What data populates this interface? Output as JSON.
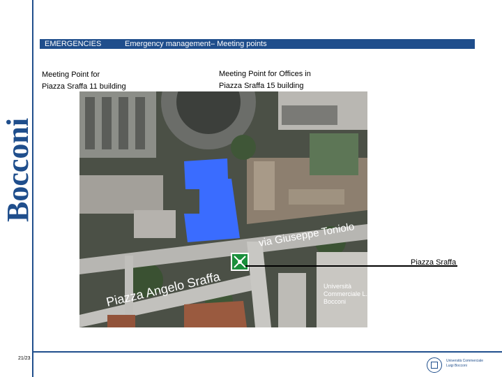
{
  "header": {
    "section": "EMERGENCIES",
    "title": "Emergency management– Meeting points"
  },
  "labels": {
    "left": {
      "line1": "Meeting Point for",
      "line2": "Piazza Sraffa 11 building"
    },
    "right": {
      "line1": "Meeting Point for Offices in",
      "line2": "Piazza Sraffa 15 building"
    }
  },
  "map": {
    "street_label_1": "via Giuseppe Toniolo",
    "street_label_2": "Piazza Angelo Sraffa",
    "building_label": "Università\nCommerciale L.\nBocconi",
    "highlight_color": "#3a6cff",
    "meeting_icon": "assembly-point-icon"
  },
  "pointer": {
    "label": "Piazza Sraffa"
  },
  "branding": {
    "vertical_name": "Bocconi",
    "footer_name_line1": "Università Commerciale",
    "footer_name_line2": "Luigi Bocconi"
  },
  "page": {
    "number": "21/23"
  }
}
